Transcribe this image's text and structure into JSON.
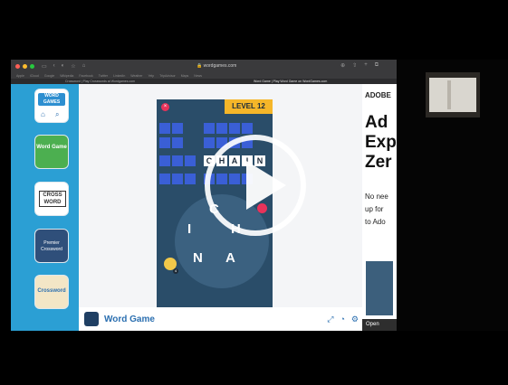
{
  "browser": {
    "url": "wordgames.com",
    "tabs": [
      "Crossword | Play Crosswords at Wordgames.com",
      "Word Game | Play Word Game on WordGames.com"
    ],
    "bookmarks": [
      "Apple",
      "iCloud",
      "Google",
      "Wikipedia",
      "Facebook",
      "Twitter",
      "LinkedIn",
      "Weather",
      "Yelp",
      "TripAdvisor",
      "Maps",
      "News"
    ]
  },
  "sidebar": {
    "tiles": [
      {
        "label": "WORD GAMES",
        "color": "#ffffff"
      },
      {
        "label": "Word Game",
        "color": "#4caf50"
      },
      {
        "label": "CROSS WORD",
        "color": "#ffffff"
      },
      {
        "label": "Premier Crossword",
        "color": "#2f4f7a"
      },
      {
        "label": "Crossword",
        "color": "#f3e6c6"
      }
    ]
  },
  "game": {
    "level": "LEVEL 12",
    "solved_word": [
      "C",
      "H",
      "A",
      "I",
      "N"
    ],
    "wheel_letters": [
      "C",
      "I",
      "H",
      "N",
      "A"
    ],
    "hint_count": "4",
    "brand": "Word Game"
  },
  "ad": {
    "kicker": "ADOBE",
    "headline_lines": [
      "Ad",
      "Exp",
      "Zer"
    ],
    "body_lines": [
      "No nee",
      "up for",
      "to Ado"
    ],
    "cta": "Open"
  },
  "colors": {
    "page_blue": "#2b9fd4",
    "game_bg": "#2a4d69",
    "tile_blue": "#3a5fd6",
    "level_yellow": "#f5b629",
    "accent_pink": "#e8335a"
  },
  "icons": {
    "play_overlay": "play-icon",
    "home": "home-icon",
    "search": "search-icon",
    "bulb": "lightbulb-icon",
    "shuffle": "shuffle-icon"
  }
}
